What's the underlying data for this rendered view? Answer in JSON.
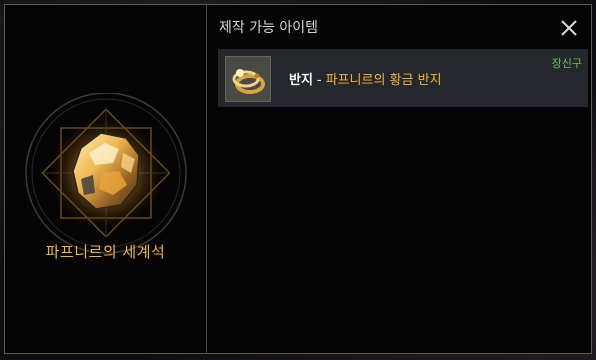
{
  "panel": {
    "title": "제작 가능 아이템",
    "close_icon": "close-icon"
  },
  "material": {
    "name": "파프니르의 세계석",
    "icon": "gold-ore-icon",
    "name_color": "#e7b649"
  },
  "craftables": [
    {
      "icon": "gold-ring-icon",
      "type": "반지",
      "separator": "-",
      "name": "파프니르의 황금 반지",
      "category": "장신구",
      "name_color": "#f0b43a",
      "category_color": "#72c05a"
    }
  ]
}
